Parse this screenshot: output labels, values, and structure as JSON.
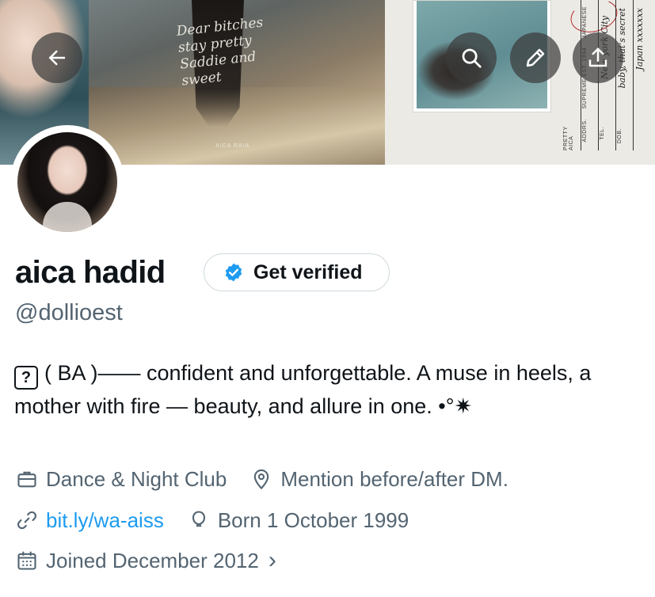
{
  "banner": {
    "script_lines": [
      "Dear bitches",
      "stay pretty",
      "Saddie and",
      "sweet"
    ],
    "small_caption": "AICA RAIA",
    "form_labels": [
      "ADDRS.",
      "TEL.",
      "DOB.",
      "SUPREME EST. 1994",
      "JAPANESE",
      "PRETTY AICA"
    ],
    "form_handwriting": [
      "New york City",
      "baby, that's secret",
      "Japan xxxxxxx"
    ]
  },
  "actions": {
    "back": "back-arrow-icon",
    "search": "search-icon",
    "edit": "pencil-icon",
    "share": "share-icon"
  },
  "profile": {
    "name": "aica hadid",
    "verify_label": "Get verified",
    "handle": "@dollioest",
    "bio_icon_glyph": "?",
    "bio_text": "( BA )—— confident and unforgettable. A muse in heels, a mother with fire — beauty, and allure in one. •°✷",
    "category": "Dance & Night Club",
    "location": "Mention before/after DM.",
    "website": "bit.ly/wa-aiss",
    "birthday": "Born 1 October 1999",
    "joined": "Joined December 2012",
    "joined_chevron": "›"
  },
  "colors": {
    "text_primary": "#0f1419",
    "text_secondary": "#536471",
    "link": "#1d9bf0",
    "verify_badge": "#1d9bf0",
    "overlay_button": "#3c3c3c"
  }
}
